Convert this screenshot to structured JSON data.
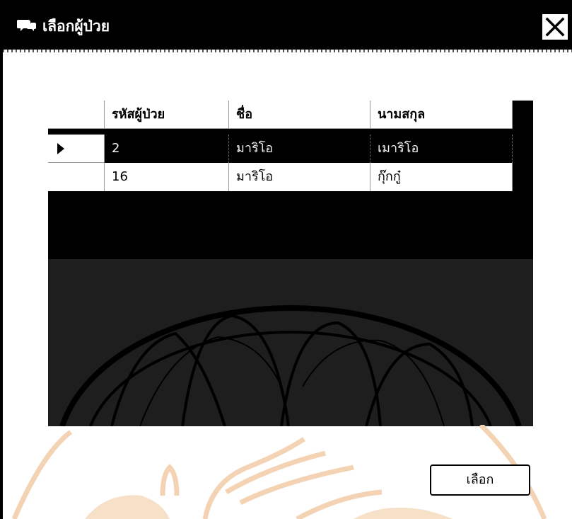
{
  "window": {
    "title": "เลือกผู้ป่วย",
    "title_icon": "chat-bubbles-icon",
    "close_icon": "close-icon"
  },
  "grid": {
    "columns": [
      "รหัสผู้ป่วย",
      "ชื่อ",
      "นามสกุล"
    ],
    "rows": [
      {
        "selected": true,
        "cells": [
          "2",
          "มาริโอ",
          "เมาริโอ"
        ]
      },
      {
        "selected": false,
        "cells": [
          "16",
          "มาริโอ",
          "กุ๊กกู๋"
        ]
      }
    ],
    "current_row_icon": "triangle-right-icon"
  },
  "buttons": {
    "select_label": "เลือก"
  },
  "colors": {
    "title_bar": "#000000",
    "grid_background": "#000000",
    "grid_lower": "#1e1e1e",
    "watermark": "#f3d3b4"
  }
}
